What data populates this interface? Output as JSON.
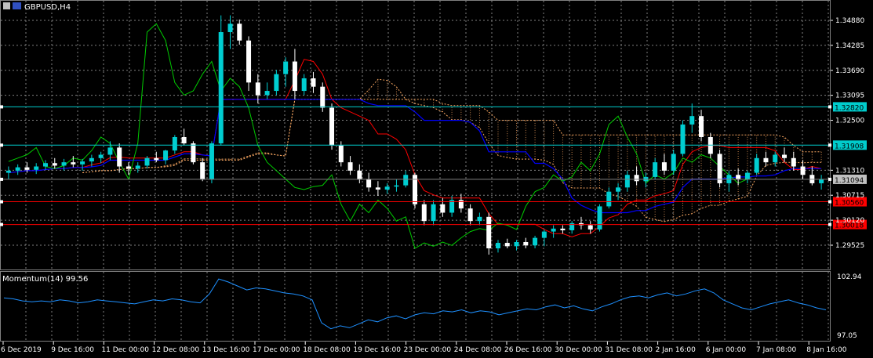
{
  "window": {
    "symbol_label": "GBPUSD,H4"
  },
  "main_panel": {
    "price_axis": [
      "1.34880",
      "1.34285",
      "1.33690",
      "1.33095",
      "1.32500",
      "1.31310",
      "1.30715",
      "1.30120",
      "1.29525"
    ],
    "price_lines": [
      {
        "label": "1.32820",
        "value": 1.3282,
        "color": "#00cccc",
        "bg": "#00cccc",
        "fg": "#000000"
      },
      {
        "label": "1.31908",
        "value": 1.31908,
        "color": "#00cccc",
        "bg": "#00cccc",
        "fg": "#000000"
      },
      {
        "label": "1.31094",
        "value": 1.31094,
        "color": "#808080",
        "bg": "#c0c0c0",
        "fg": "#000000"
      },
      {
        "label": "1.30560",
        "value": 1.3056,
        "color": "#ff0000",
        "bg": "#ff0000",
        "fg": "#000000"
      },
      {
        "label": "1.30018",
        "value": 1.30018,
        "color": "#ff0000",
        "bg": "#ff0000",
        "fg": "#000000"
      }
    ]
  },
  "indicator_panel": {
    "label": "Momentum(14) 99.56",
    "axis": [
      "102.94",
      "97.05"
    ]
  },
  "time_axis": [
    "6 Dec 2019",
    "9 Dec 16:00",
    "11 Dec 00:00",
    "12 Dec 08:00",
    "13 Dec 16:00",
    "17 Dec 00:00",
    "18 Dec 08:00",
    "19 Dec 16:00",
    "23 Dec 00:00",
    "24 Dec 08:00",
    "26 Dec 16:00",
    "30 Dec 00:00",
    "31 Dec 08:00",
    "2 Jan 16:00",
    "6 Jan 00:00",
    "7 Jan 08:00",
    "8 Jan 16:00"
  ],
  "colors": {
    "bull": "#00ced1",
    "bear": "#ffffff",
    "tenkan": "#ff0000",
    "kijun": "#0000ff",
    "chikou": "#00cc00",
    "span": "#f4a460",
    "ma": "#ff00ff",
    "momentum": "#1e90ff",
    "grid": "#808080"
  },
  "chart_data": {
    "type": "candlestick",
    "symbol": "GBPUSD",
    "timeframe": "H4",
    "ylim": [
      1.2925,
      1.3505
    ],
    "candles": [
      [
        1.3125,
        1.314,
        1.311,
        1.313
      ],
      [
        1.313,
        1.3145,
        1.312,
        1.3138
      ],
      [
        1.3138,
        1.315,
        1.3125,
        1.3132
      ],
      [
        1.3132,
        1.3148,
        1.3122,
        1.314
      ],
      [
        1.314,
        1.3155,
        1.3132,
        1.3148
      ],
      [
        1.3148,
        1.316,
        1.3135,
        1.3142
      ],
      [
        1.3142,
        1.3158,
        1.313,
        1.315
      ],
      [
        1.315,
        1.3165,
        1.3138,
        1.3145
      ],
      [
        1.3145,
        1.3158,
        1.313,
        1.3152
      ],
      [
        1.3152,
        1.3168,
        1.314,
        1.316
      ],
      [
        1.316,
        1.3175,
        1.3148,
        1.3168
      ],
      [
        1.3168,
        1.32,
        1.3155,
        1.3185
      ],
      [
        1.3185,
        1.3195,
        1.3125,
        1.314
      ],
      [
        1.314,
        1.315,
        1.312,
        1.3135
      ],
      [
        1.3135,
        1.315,
        1.3125,
        1.3142
      ],
      [
        1.3142,
        1.3165,
        1.3135,
        1.316
      ],
      [
        1.316,
        1.3175,
        1.315,
        1.3155
      ],
      [
        1.3155,
        1.318,
        1.3145,
        1.3178
      ],
      [
        1.3178,
        1.3215,
        1.317,
        1.321
      ],
      [
        1.321,
        1.323,
        1.319,
        1.3195
      ],
      [
        1.3195,
        1.32,
        1.3145,
        1.315
      ],
      [
        1.315,
        1.316,
        1.3105,
        1.311
      ],
      [
        1.311,
        1.32,
        1.31,
        1.3195
      ],
      [
        1.3195,
        1.35,
        1.319,
        1.346
      ],
      [
        1.346,
        1.35,
        1.342,
        1.348
      ],
      [
        1.348,
        1.349,
        1.343,
        1.344
      ],
      [
        1.344,
        1.345,
        1.332,
        1.334
      ],
      [
        1.334,
        1.336,
        1.329,
        1.331
      ],
      [
        1.331,
        1.334,
        1.33,
        1.332
      ],
      [
        1.332,
        1.337,
        1.331,
        1.336
      ],
      [
        1.336,
        1.34,
        1.333,
        1.339
      ],
      [
        1.339,
        1.342,
        1.33,
        1.332
      ],
      [
        1.332,
        1.336,
        1.331,
        1.335
      ],
      [
        1.335,
        1.3365,
        1.3315,
        1.333
      ],
      [
        1.333,
        1.334,
        1.327,
        1.328
      ],
      [
        1.328,
        1.329,
        1.318,
        1.319
      ],
      [
        1.319,
        1.32,
        1.314,
        1.315
      ],
      [
        1.315,
        1.3165,
        1.312,
        1.313
      ],
      [
        1.313,
        1.3145,
        1.31,
        1.311
      ],
      [
        1.311,
        1.3125,
        1.308,
        1.309
      ],
      [
        1.309,
        1.3105,
        1.307,
        1.3085
      ],
      [
        1.3085,
        1.31,
        1.3075,
        1.3092
      ],
      [
        1.3092,
        1.311,
        1.308,
        1.3095
      ],
      [
        1.3095,
        1.313,
        1.309,
        1.312
      ],
      [
        1.312,
        1.3125,
        1.304,
        1.305
      ],
      [
        1.305,
        1.306,
        1.3,
        1.301
      ],
      [
        1.301,
        1.306,
        1.3,
        1.305
      ],
      [
        1.305,
        1.3065,
        1.302,
        1.303
      ],
      [
        1.303,
        1.307,
        1.302,
        1.306
      ],
      [
        1.306,
        1.3075,
        1.303,
        1.304
      ],
      [
        1.304,
        1.305,
        1.3,
        1.301
      ],
      [
        1.301,
        1.303,
        1.3,
        1.302
      ],
      [
        1.302,
        1.303,
        1.293,
        1.2945
      ],
      [
        1.2945,
        1.2965,
        1.2935,
        1.2958
      ],
      [
        1.2958,
        1.2968,
        1.2945,
        1.295
      ],
      [
        1.295,
        1.2965,
        1.294,
        1.296
      ],
      [
        1.296,
        1.297,
        1.2945,
        1.2952
      ],
      [
        1.2952,
        1.2975,
        1.2945,
        1.297
      ],
      [
        1.297,
        1.299,
        1.295,
        1.2985
      ],
      [
        1.2985,
        1.3,
        1.297,
        1.2992
      ],
      [
        1.2992,
        1.3,
        1.298,
        1.2988
      ],
      [
        1.2988,
        1.301,
        1.298,
        1.3005
      ],
      [
        1.3005,
        1.302,
        1.299,
        1.3
      ],
      [
        1.3,
        1.301,
        1.298,
        1.299
      ],
      [
        1.299,
        1.305,
        1.2985,
        1.3045
      ],
      [
        1.3045,
        1.309,
        1.304,
        1.308
      ],
      [
        1.308,
        1.31,
        1.306,
        1.309
      ],
      [
        1.309,
        1.313,
        1.308,
        1.312
      ],
      [
        1.312,
        1.314,
        1.3095,
        1.3105
      ],
      [
        1.3105,
        1.3125,
        1.309,
        1.3115
      ],
      [
        1.3115,
        1.316,
        1.311,
        1.315
      ],
      [
        1.315,
        1.317,
        1.312,
        1.313
      ],
      [
        1.313,
        1.318,
        1.312,
        1.317
      ],
      [
        1.317,
        1.325,
        1.3165,
        1.324
      ],
      [
        1.324,
        1.329,
        1.322,
        1.326
      ],
      [
        1.326,
        1.3275,
        1.32,
        1.321
      ],
      [
        1.321,
        1.322,
        1.316,
        1.317
      ],
      [
        1.317,
        1.318,
        1.309,
        1.31
      ],
      [
        1.31,
        1.313,
        1.308,
        1.312
      ],
      [
        1.312,
        1.3135,
        1.3095,
        1.311
      ],
      [
        1.311,
        1.313,
        1.31,
        1.3125
      ],
      [
        1.3125,
        1.317,
        1.312,
        1.316
      ],
      [
        1.316,
        1.3175,
        1.314,
        1.315
      ],
      [
        1.315,
        1.3175,
        1.314,
        1.3168
      ],
      [
        1.3168,
        1.3185,
        1.315,
        1.316
      ],
      [
        1.316,
        1.3175,
        1.313,
        1.314
      ],
      [
        1.314,
        1.3155,
        1.311,
        1.312
      ],
      [
        1.312,
        1.314,
        1.3095,
        1.31
      ],
      [
        1.31,
        1.312,
        1.3085,
        1.311
      ]
    ],
    "momentum": [
      100.8,
      100.7,
      100.5,
      100.4,
      100.5,
      100.4,
      100.6,
      100.5,
      100.3,
      100.4,
      100.6,
      100.5,
      100.4,
      100.3,
      100.2,
      100.4,
      100.6,
      100.5,
      100.7,
      100.6,
      100.4,
      100.3,
      101.2,
      102.7,
      102.4,
      102.0,
      101.6,
      101.8,
      101.7,
      101.5,
      101.3,
      101.2,
      101.0,
      100.6,
      98.3,
      97.7,
      98.0,
      97.8,
      98.2,
      98.6,
      98.4,
      98.8,
      99.0,
      98.7,
      99.1,
      99.3,
      99.2,
      99.5,
      99.4,
      99.6,
      99.3,
      99.5,
      99.4,
      99.1,
      99.3,
      99.5,
      99.7,
      99.6,
      99.9,
      100.1,
      99.8,
      100.0,
      99.7,
      99.5,
      99.9,
      100.2,
      100.6,
      100.9,
      101.0,
      100.8,
      101.1,
      101.3,
      101.0,
      101.2,
      101.5,
      101.7,
      101.3,
      100.6,
      100.2,
      99.8,
      99.6,
      99.9,
      100.2,
      100.4,
      100.6,
      100.3,
      100.1,
      99.8,
      99.6
    ]
  }
}
